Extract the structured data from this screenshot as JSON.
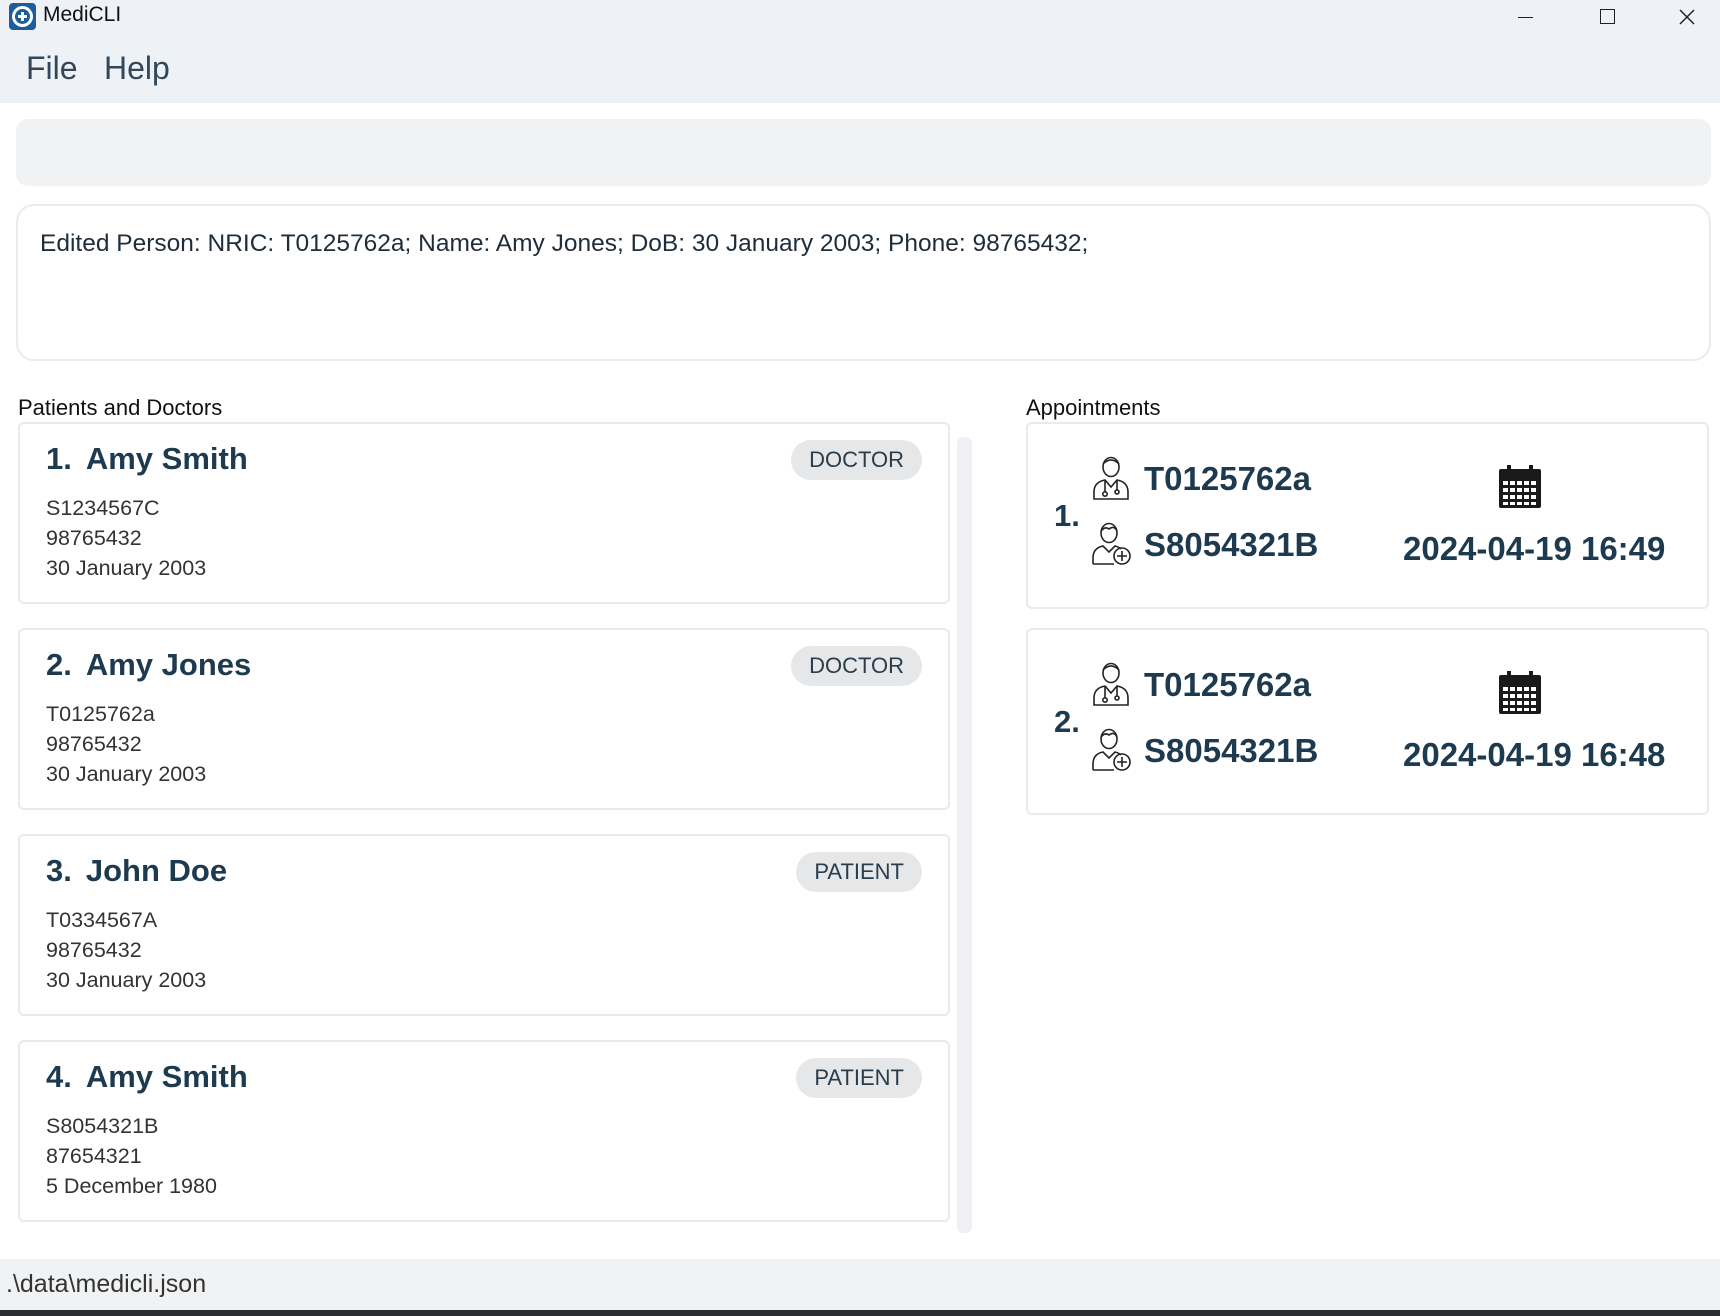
{
  "window": {
    "title": "MediCLI",
    "app_icon": "medical-cross-icon"
  },
  "menu": {
    "file_label": "File",
    "help_label": "Help"
  },
  "command": {
    "value": "",
    "placeholder": ""
  },
  "result": {
    "text": "Edited Person: NRIC: T0125762a; Name: Amy Jones; DoB: 30 January 2003; Phone: 98765432;"
  },
  "people_panel": {
    "label": "Patients and Doctors",
    "items": [
      {
        "index": "1.",
        "name": "Amy Smith",
        "role": "DOCTOR",
        "nric": "S1234567C",
        "phone": "98765432",
        "dob": "30 January 2003"
      },
      {
        "index": "2.",
        "name": "Amy Jones",
        "role": "DOCTOR",
        "nric": "T0125762a",
        "phone": "98765432",
        "dob": "30 January 2003"
      },
      {
        "index": "3.",
        "name": "John Doe",
        "role": "PATIENT",
        "nric": "T0334567A",
        "phone": "98765432",
        "dob": "30 January 2003"
      },
      {
        "index": "4.",
        "name": "Amy Smith",
        "role": "PATIENT",
        "nric": "S8054321B",
        "phone": "87654321",
        "dob": "5 December 1980"
      }
    ]
  },
  "appointments_panel": {
    "label": "Appointments",
    "items": [
      {
        "index": "1.",
        "doctor_nric": "T0125762a",
        "patient_nric": "S8054321B",
        "datetime": "2024-04-19 16:49",
        "doctor_icon": "doctor-icon",
        "patient_icon": "patient-icon",
        "date_icon": "calendar-icon"
      },
      {
        "index": "2.",
        "doctor_nric": "T0125762a",
        "patient_nric": "S8054321B",
        "datetime": "2024-04-19 16:48",
        "doctor_icon": "doctor-icon",
        "patient_icon": "patient-icon",
        "date_icon": "calendar-icon"
      }
    ]
  },
  "status": {
    "file_path": ".\\data\\medicli.json"
  },
  "colors": {
    "accent": "#1d3a4f",
    "badge_bg": "#e5e7e9",
    "titlebar_bg": "#eef2f7"
  }
}
